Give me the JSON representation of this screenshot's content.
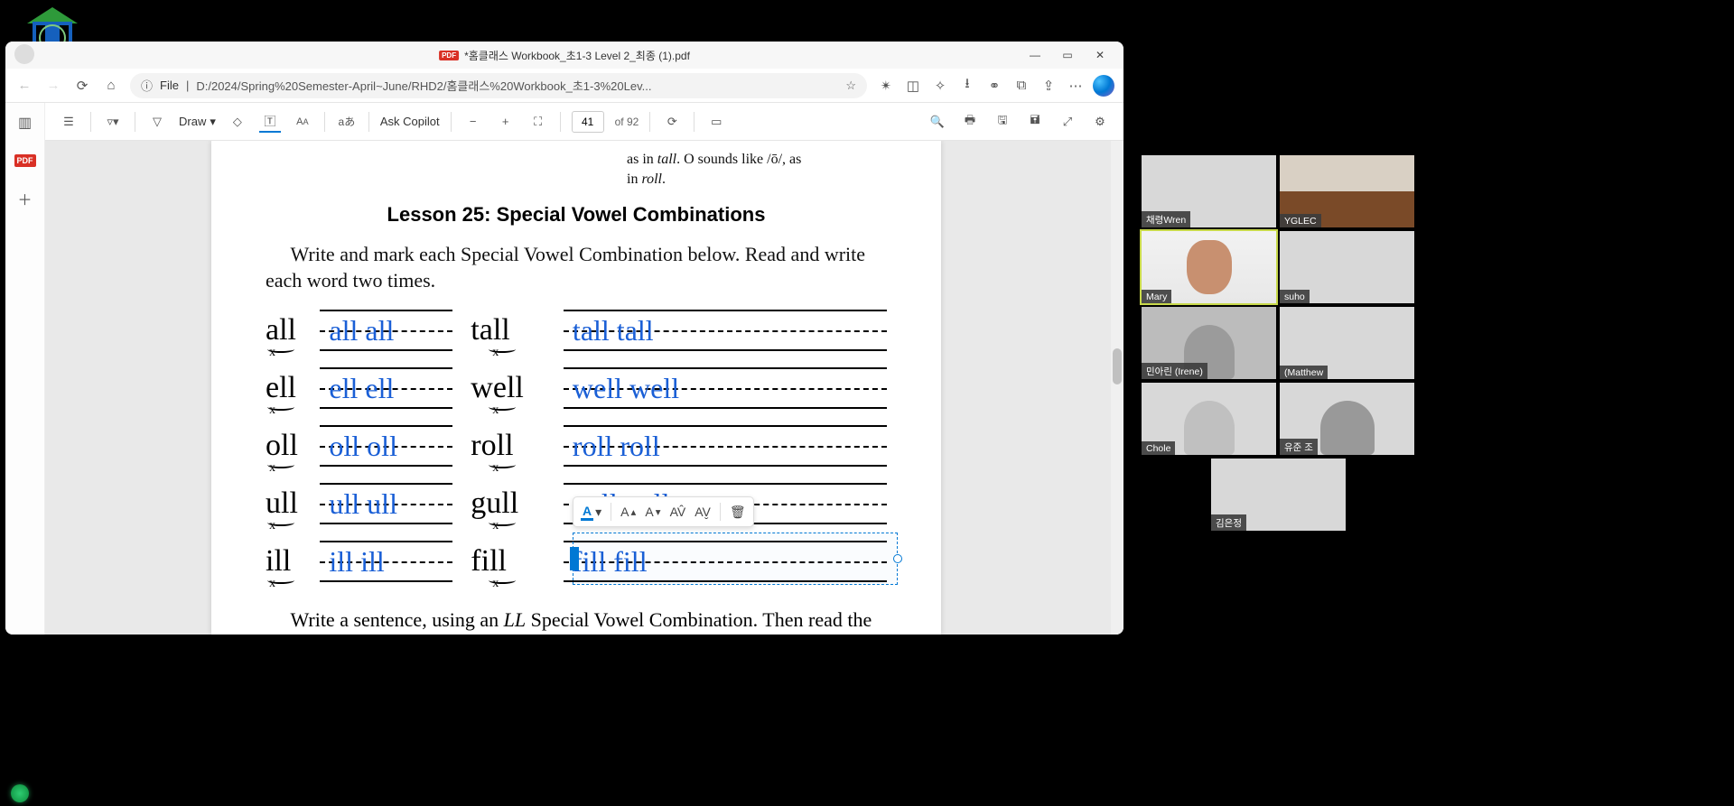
{
  "window": {
    "title": "*홈클래스 Workbook_초1-3 Level 2_최종 (1).pdf",
    "min": "—",
    "max": "▭",
    "close": "✕"
  },
  "address": {
    "file_label": "File",
    "url": "D:/2024/Spring%20Semester-April~June/RHD2/홈클래스%20Workbook_초1-3%20Lev...",
    "info_icon": "ⓘ"
  },
  "pdfbar": {
    "draw": "Draw",
    "ask": "Ask Copilot",
    "page": "41",
    "of": "of 92",
    "lang": "aあ"
  },
  "document": {
    "partial_top": "as in tall. O sounds like /ō/, as in roll.",
    "lesson_title": "Lesson 25: Special Vowel Combinations",
    "instr": "Write and mark each Special Vowel Combination below. Read and write each word two times.",
    "instr2_a": "Write a sentence, using an ",
    "instr2_em": "LL",
    "instr2_b": " Special Vowel Combination. Then read the sentence.",
    "rows": [
      {
        "syll": "all",
        "p1": "all  all",
        "ex": "tall",
        "p2": "tall    tall"
      },
      {
        "syll": "ell",
        "p1": "ell  ell",
        "ex": "well",
        "p2": "well    well"
      },
      {
        "syll": "oll",
        "p1": "oll   oll",
        "ex": "roll",
        "p2": "roll    roll"
      },
      {
        "syll": "ull",
        "p1": "ull   ull",
        "ex": "gull",
        "p2": "gull   gull"
      },
      {
        "syll": "ill",
        "p1": "ill  ill",
        "ex": "fill",
        "p2": "fill    fill"
      }
    ]
  },
  "participants": [
    {
      "name": "채령Wren"
    },
    {
      "name": "YGLEC"
    },
    {
      "name": "Mary"
    },
    {
      "name": "suho"
    },
    {
      "name": "민아린 (Irene)"
    },
    {
      "name": "(Matthew"
    },
    {
      "name": "Chole"
    },
    {
      "name": "유준 조"
    },
    {
      "name": "김은정"
    }
  ]
}
